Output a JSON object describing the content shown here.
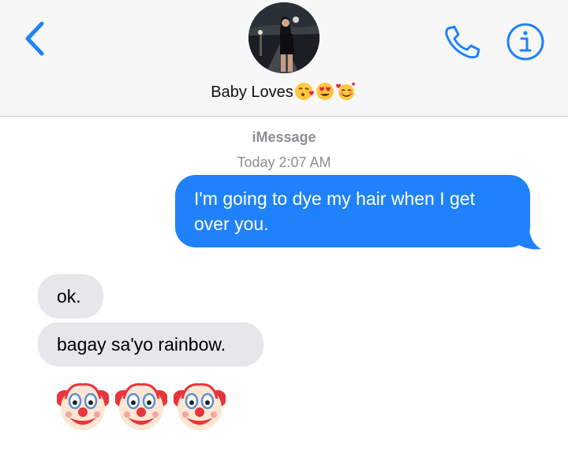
{
  "header": {
    "contact_name": "Baby Loves",
    "name_emojis": [
      "face-blowing-kiss",
      "heart-eyes",
      "smiling-face-with-hearts"
    ],
    "back_icon": "chevron-left-icon",
    "call_icon": "phone-icon",
    "info_icon": "info-icon"
  },
  "conversation": {
    "service": "iMessage",
    "timestamp": "Today 2:07 AM",
    "messages": [
      {
        "direction": "outgoing",
        "text": "I'm going to dye my hair when I get over you."
      },
      {
        "direction": "incoming",
        "text": "ok."
      },
      {
        "direction": "incoming",
        "text": "bagay sa'yo rainbow."
      },
      {
        "direction": "incoming",
        "emoji": [
          "clown-face",
          "clown-face",
          "clown-face"
        ]
      }
    ]
  },
  "colors": {
    "accent": "#1f82fb",
    "outgoing_bubble": "#1f82fb",
    "incoming_bubble": "#e6e6eb",
    "meta_text": "#8e8e93",
    "header_bg": "#f7f7f7"
  }
}
